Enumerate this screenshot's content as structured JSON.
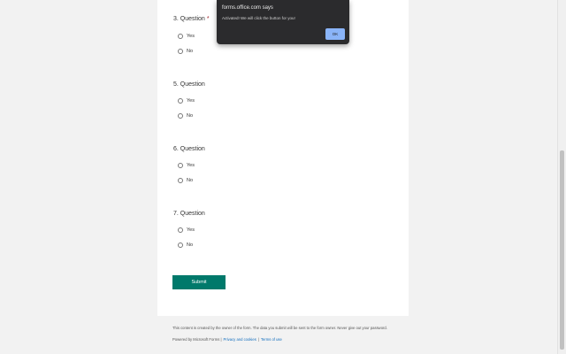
{
  "questions": [
    {
      "title": "3. Question",
      "required_mark": "*",
      "options": [
        "Yes",
        "No"
      ]
    },
    {
      "title": "5. Question",
      "options": [
        "Yes",
        "No"
      ]
    },
    {
      "title": "6. Question",
      "options": [
        "Yes",
        "No"
      ]
    },
    {
      "title": "7. Question",
      "options": [
        "Yes",
        "No"
      ]
    }
  ],
  "submit_label": "Submit",
  "footer": {
    "disclaimer": "This content is created by the owner of the form. The data you submit will be sent to the form owner. Never give out your password.",
    "powered_by": "Powered by Microsoft Forms |",
    "privacy": "Privacy and cookies",
    "sep": "|",
    "terms": "Terms of use"
  },
  "dialog": {
    "title": "forms.office.com says",
    "message": "Activated! We will click the button for you!",
    "ok_label": "OK"
  },
  "colors": {
    "accent": "#00796b",
    "dialog_bg": "#2b2b2d",
    "ok_button": "#8ab4f8"
  }
}
